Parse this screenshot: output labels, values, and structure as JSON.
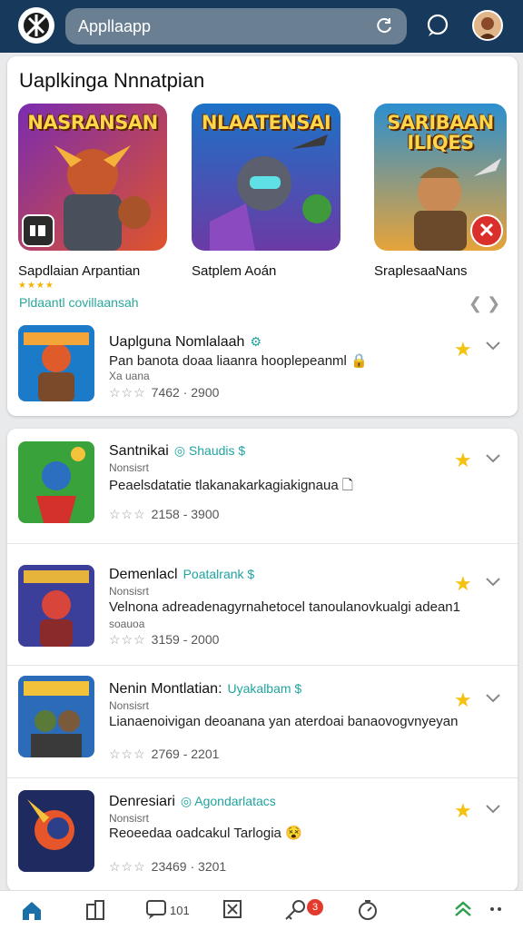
{
  "header": {
    "search_value": "Appllaapp",
    "icons": {
      "logo": "logo-icon",
      "refresh": "refresh-icon",
      "chat": "chat-icon",
      "avatar": "avatar"
    }
  },
  "featured": {
    "heading": "Uaplkinga Nnnatpian",
    "tiles": [
      {
        "art_title": "NASRANSAN",
        "name": "Sapdlaian Arpantian",
        "colors": [
          "#6b2aa0",
          "#e04b2b"
        ]
      },
      {
        "art_title": "NLAATENSAI",
        "name": "Satplem Aoán",
        "colors": [
          "#1b6fc2",
          "#f3c43b"
        ]
      },
      {
        "art_title": "SARIBAAN ILIQES",
        "name": "SraplesaaNans",
        "colors": [
          "#2e8ec9",
          "#f1d54a"
        ]
      }
    ],
    "rating_stars": "★★★★",
    "link_text": "Pldaantl covillaansah",
    "nav_glyph": "❮ ❯"
  },
  "apps": [
    {
      "name": "Uaplguna Nomlalaah",
      "developer": "⚙",
      "subline": "",
      "description": "Pan banota doaa liaanra hooplepeanml 🔒",
      "description2": "Xa uana",
      "meta": "7462 · 2900",
      "stars": "☆☆☆",
      "icon_colors": [
        "#1c7bc9",
        "#f3a53a"
      ]
    },
    {
      "name": "Santnikai",
      "developer": "◎ Shaudis $",
      "subline": "Nonsisrt",
      "description": "Peaelsdatatie tlakanakarkagiakignaua 🗋",
      "description2": "",
      "meta": "2158 - 3900",
      "stars": "☆☆☆",
      "icon_colors": [
        "#3aa23a",
        "#d4302c"
      ]
    },
    {
      "name": "Demenlacl",
      "developer": "Poatalrank $",
      "subline": "Nonsisrt",
      "description": "Velnona adreadenagyrnahetocel tanoulanovkualgi adean1",
      "description2": "soauoa",
      "meta": "3159 - 2000",
      "stars": "☆☆☆",
      "icon_colors": [
        "#3b3f9a",
        "#e05b2a"
      ]
    },
    {
      "name": "Nenin Montlatian:",
      "developer": "Uyakalbam $",
      "subline": "Nonsisrt",
      "description": "Lianaenoivigan deoanana yan aterdoai banaovogvnyeyan",
      "description2": "",
      "meta": "2769 - 2201",
      "stars": "☆☆☆",
      "icon_colors": [
        "#2b6bb8",
        "#f2c33a"
      ]
    },
    {
      "name": "Denresiari",
      "developer": "◎ Agondarlatacs",
      "subline": "Nonsisrt",
      "description": "Reoeedaa oadcakul Tarlogia 😵",
      "description2": "",
      "meta": "23469 · 3201",
      "stars": "☆☆☆",
      "icon_colors": [
        "#1e2a60",
        "#e7562a"
      ]
    }
  ],
  "bottom_nav": {
    "chat_count": "101",
    "notif_badge": "3",
    "icons": [
      "home-icon",
      "library-icon",
      "chat-icon",
      "crop-icon",
      "key-icon",
      "timer-icon",
      "up-icon",
      "more-icon"
    ]
  },
  "colors": {
    "header_bg": "#173a5c",
    "accent": "#1fa4a0",
    "star": "#f5c20f"
  }
}
